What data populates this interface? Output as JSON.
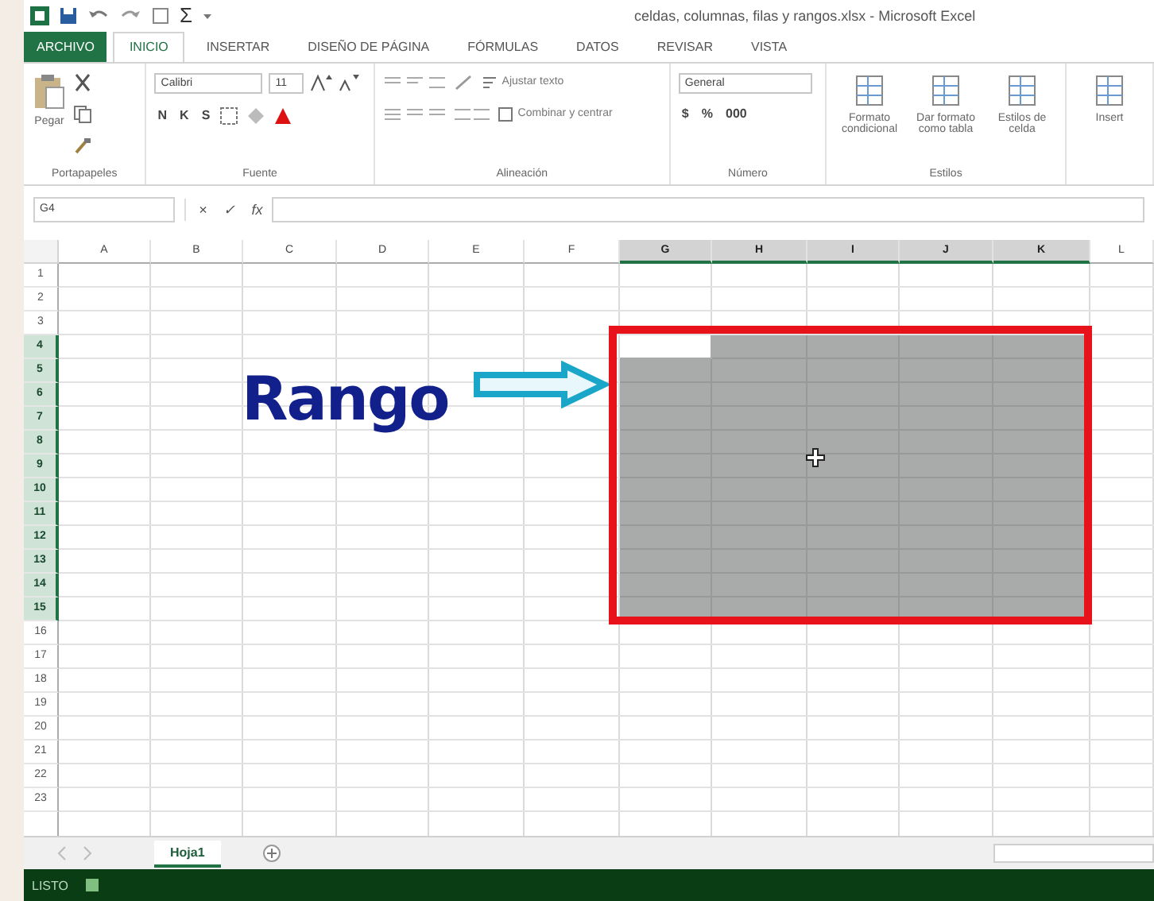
{
  "window": {
    "title": "celdas, columnas, filas y rangos.xlsx - Microsoft Excel",
    "quick_access": [
      "Σ"
    ]
  },
  "tabs": [
    {
      "label": "ARCHIVO",
      "kind": "file",
      "selected": false
    },
    {
      "label": "INICIO",
      "kind": "tab",
      "selected": true
    },
    {
      "label": "INSERTAR",
      "kind": "tab",
      "selected": false
    },
    {
      "label": "DISEÑO DE PÁGINA",
      "kind": "tab",
      "selected": false
    },
    {
      "label": "FÓRMULAS",
      "kind": "tab",
      "selected": false
    },
    {
      "label": "DATOS",
      "kind": "tab",
      "selected": false
    },
    {
      "label": "REVISAR",
      "kind": "tab",
      "selected": false
    },
    {
      "label": "VISTA",
      "kind": "tab",
      "selected": false
    }
  ],
  "ribbon": {
    "groups": [
      {
        "kind": "clipboard",
        "label": "Portapapeles",
        "items": [
          "Pegar"
        ]
      },
      {
        "kind": "font",
        "label": "Fuente",
        "font": "Calibri",
        "size": "11",
        "buttons": [
          "N",
          "K",
          "S"
        ]
      },
      {
        "kind": "align",
        "label": "Alineación",
        "items": [
          "Ajustar texto",
          "Combinar y centrar"
        ]
      },
      {
        "kind": "number",
        "label": "Número",
        "format": "General",
        "buttons": [
          "$",
          "%",
          "000"
        ]
      },
      {
        "kind": "styles",
        "label": "Estilos",
        "items": [
          "Formato condicional",
          "Dar formato como tabla",
          "Estilos de celda"
        ]
      },
      {
        "kind": "cells",
        "items": [
          "Insert"
        ]
      }
    ]
  },
  "formula_bar": {
    "name_box": "G4",
    "buttons": [
      "×",
      "✓",
      "fx"
    ]
  },
  "sheet": {
    "columns": [
      {
        "label": "A",
        "selected": false,
        "active": false
      },
      {
        "label": "B",
        "selected": false,
        "active": false
      },
      {
        "label": "C",
        "selected": false,
        "active": false
      },
      {
        "label": "D",
        "selected": false,
        "active": false
      },
      {
        "label": "E",
        "selected": false,
        "active": false
      },
      {
        "label": "F",
        "selected": false,
        "active": false
      },
      {
        "label": "G",
        "selected": true,
        "active": true
      },
      {
        "label": "H",
        "selected": true,
        "active": false
      },
      {
        "label": "I",
        "selected": true,
        "active": false
      },
      {
        "label": "J",
        "selected": true,
        "active": false
      },
      {
        "label": "K",
        "selected": true,
        "active": false
      },
      {
        "label": "L",
        "selected": false,
        "active": false
      }
    ],
    "rows": [
      {
        "label": "1",
        "selected": false,
        "active": false
      },
      {
        "label": "2",
        "selected": false,
        "active": false
      },
      {
        "label": "3",
        "selected": false,
        "active": false
      },
      {
        "label": "4",
        "selected": true,
        "active": true
      },
      {
        "label": "5",
        "selected": true,
        "active": false
      },
      {
        "label": "6",
        "selected": true,
        "active": false
      },
      {
        "label": "7",
        "selected": true,
        "active": false
      },
      {
        "label": "8",
        "selected": true,
        "active": false
      },
      {
        "label": "9",
        "selected": true,
        "active": false
      },
      {
        "label": "10",
        "selected": true,
        "active": false
      },
      {
        "label": "11",
        "selected": true,
        "active": false
      },
      {
        "label": "12",
        "selected": true,
        "active": false
      },
      {
        "label": "13",
        "selected": true,
        "active": false
      },
      {
        "label": "14",
        "selected": true,
        "active": false
      },
      {
        "label": "15",
        "selected": true,
        "active": false
      },
      {
        "label": "16",
        "selected": false,
        "active": false
      },
      {
        "label": "17",
        "selected": false,
        "active": false
      },
      {
        "label": "18",
        "selected": false,
        "active": false
      },
      {
        "label": "19",
        "selected": false,
        "active": false
      },
      {
        "label": "20",
        "selected": false,
        "active": false
      },
      {
        "label": "21",
        "selected": false,
        "active": false
      },
      {
        "label": "22",
        "selected": false,
        "active": false
      },
      {
        "label": "23",
        "selected": false,
        "active": false
      }
    ]
  },
  "annotation": {
    "text": "Rango"
  },
  "sheet_tabs": [
    {
      "label": "Hoja1",
      "selected": true
    }
  ],
  "status_bar": {
    "text": "LISTO"
  }
}
